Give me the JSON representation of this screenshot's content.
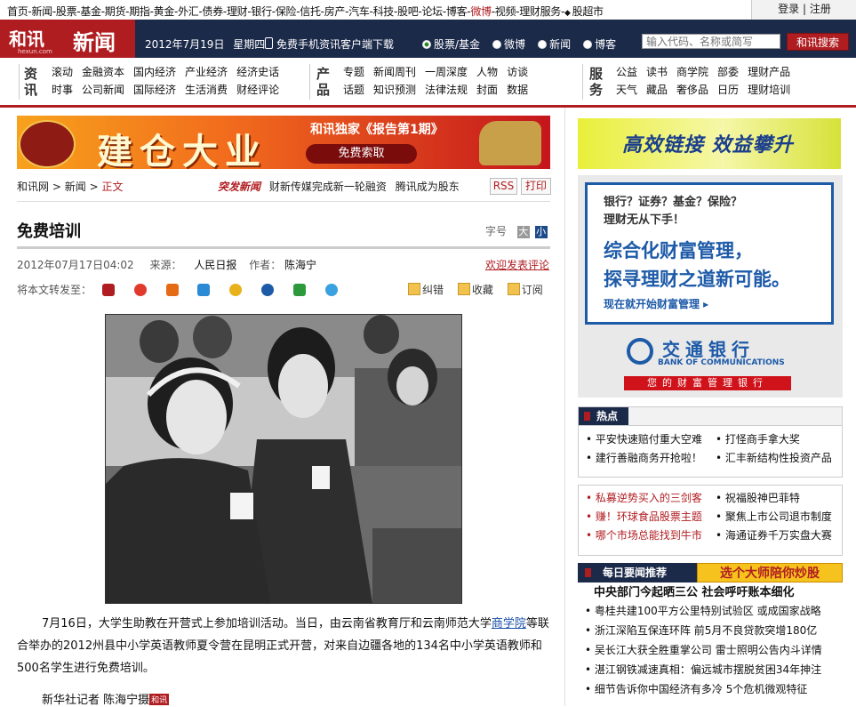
{
  "topnav": {
    "links": [
      "首页",
      "新闻",
      "股票",
      "基金",
      "期货",
      "期指",
      "黄金",
      "外汇",
      "债券",
      "理财",
      "银行",
      "保险",
      "信托",
      "房产",
      "汽车",
      "科技",
      "股吧",
      "论坛",
      "博客",
      "微博",
      "视频",
      "理财服务",
      "股超市"
    ],
    "highlight": "微博",
    "login": "登录",
    "register": "注册"
  },
  "header": {
    "logo_brand": "和讯",
    "logo_domain": "hexun.com",
    "logo_channel": "新闻",
    "date": "2012年7月19日",
    "weekday": "星期四",
    "mobile_download": "免费手机资讯客户端下载",
    "search_options": [
      "股票/基金",
      "微博",
      "新闻",
      "博客"
    ],
    "search_selected": "股票/基金",
    "search_placeholder": "输入代码、名称或简写",
    "search_button": "和讯搜索"
  },
  "channels": {
    "zixun": {
      "label": "资讯",
      "row1": [
        "滚动",
        "金融资本",
        "国内经济",
        "产业经济",
        "经济史话"
      ],
      "row2": [
        "时事",
        "公司新闻",
        "国际经济",
        "生活消费",
        "财经评论"
      ]
    },
    "chanpin": {
      "label": "产品",
      "row1": [
        "专题",
        "新闻周刊",
        "一周深度",
        "人物",
        "访谈"
      ],
      "row2": [
        "话题",
        "知识预测",
        "法律法规",
        "封面",
        "数据"
      ]
    },
    "fuwu": {
      "label": "服务",
      "row1": [
        "公益",
        "读书",
        "商学院",
        "部委",
        "理财产品"
      ],
      "row2": [
        "天气",
        "藏品",
        "奢侈品",
        "日历",
        "理财培训"
      ]
    }
  },
  "banner": {
    "headline": "建仓大业",
    "subtitle": "和讯独家《报告第1期》",
    "button": "免费索取"
  },
  "breadcrumb": {
    "items": [
      "和讯网",
      "新闻"
    ],
    "current": "正文"
  },
  "breaking": {
    "tag": "突发新闻",
    "items": [
      "财新传媒完成新一轮融资",
      "腾讯成为股东"
    ]
  },
  "rss_label": "RSS",
  "print_label": "打印",
  "article": {
    "title": "免费培训",
    "fontsize_label": "字号",
    "font_big": "大",
    "font_small": "小",
    "date": "2012年07月17日04:02",
    "source_label": "来源：",
    "source": "人民日报",
    "author_label": "作者：",
    "author": "陈海宁",
    "comment_link": "欢迎发表评论",
    "share_label": "将本文转发至：",
    "tools": [
      "纠错",
      "收藏",
      "订阅"
    ],
    "para_before": "7月16日，大学生助教在开营式上参加培训活动。当日，由云南省教育厅和云南师范大学",
    "para_link": "商学院",
    "para_after": "等联合举办的2012州县中小学英语教师夏令营在昆明正式开营，对来自边疆各地的134名中小学英语教师和500名学生进行免费培训。",
    "credit": "新华社记者  陈海宁摄",
    "credit_badge": "和讯"
  },
  "right": {
    "banner_text": "高效链接  效益攀升",
    "ad": {
      "question_1": "银行？证券？基金？保险？",
      "question_2": "理财无从下手！",
      "headline_1": "综合化财富管理，",
      "headline_2": "探寻理财之道新可能。",
      "more": "现在就开始财富管理 ▸",
      "bank_cn": "交通银行",
      "bank_en": "BANK OF COMMUNICATIONS",
      "slogan": "您的财富管理银行"
    },
    "hot": {
      "tab": "热点",
      "rows": [
        [
          "平安快速赔付重大空难",
          "打怪商手拿大奖"
        ],
        [
          "建行善融商务开抢啦！",
          "汇丰新结构性投资产品"
        ]
      ]
    },
    "hot2": {
      "rows": [
        [
          "私募逆势买入的三剑客",
          "祝福股神巴菲特"
        ],
        [
          "赚！环球食品股票主题",
          "聚焦上市公司退市制度"
        ],
        [
          "哪个市场总能找到牛市",
          "海通证券千万实盘大赛"
        ]
      ]
    },
    "daily": {
      "tab": "每日要闻推荐",
      "promo": "选个大师陪你炒股",
      "headline": "中央部门今起晒三公  社会呼吁账本细化",
      "items": [
        "粤桂共建100平方公里特别试验区  或成国家战略",
        "浙江深陷互保连环阵  前5月不良贷款突增180亿",
        "吴长江大获全胜重掌公司  雷士照明公告内斗详情",
        "湛江钢铁减速真相：偏远城市摆脱贫困34年抻注",
        "细节告诉你中国经济有多冷  5个危机微观特征"
      ]
    }
  }
}
